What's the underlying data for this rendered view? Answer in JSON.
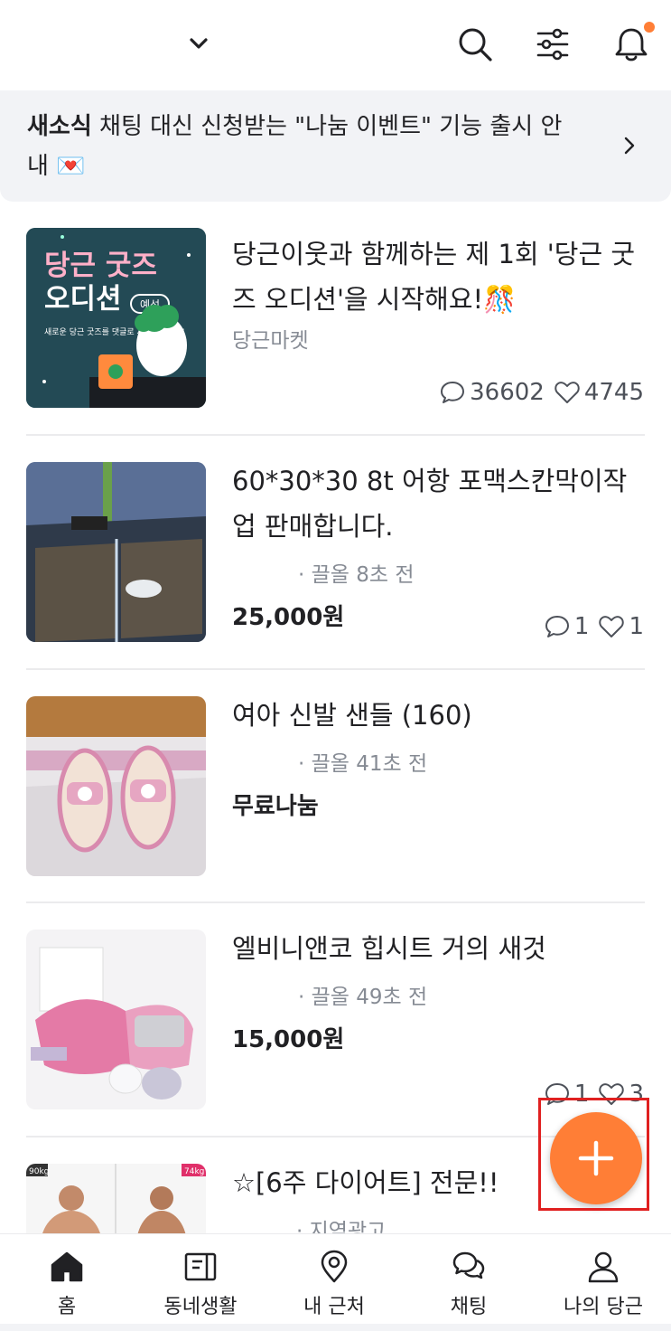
{
  "header": {
    "chevron_icon": "chevron-down-icon",
    "search_icon": "search-icon",
    "filter_icon": "sliders-icon",
    "bell_icon": "bell-icon",
    "accent": "#ff7e36"
  },
  "banner": {
    "tag": "새소식",
    "text": " 채팅 대신 신청받는 \"나눔 이벤트\" 기능 출시 안내 💌"
  },
  "feed": [
    {
      "title": "당근이웃과 함께하는 제 1회 '당근 굿즈 오디션'을 시작해요!🎊",
      "meta": "당근마켓",
      "price": "",
      "comments": "36602",
      "likes": "4745",
      "thumb_text_1": "당근 굿즈",
      "thumb_text_2": "오디션",
      "thumb_badge": "예선",
      "thumb_text_3": "새로운 당근 굿즈를 댓글로 제안해주세요!"
    },
    {
      "title": "60*30*30 8t 어항 포맥스칸막이작업 판매합니다.",
      "meta": "· 끌올 8초 전",
      "price": "25,000원",
      "comments": "1",
      "likes": "1"
    },
    {
      "title": "여아 신발 샌들 (160)",
      "meta": "· 끌올 41초 전",
      "price": "무료나눔",
      "comments": "",
      "likes": ""
    },
    {
      "title": "엘비니앤코 힙시트 거의 새것",
      "meta": "· 끌올 49초 전",
      "price": "15,000원",
      "comments": "1",
      "likes": "3"
    },
    {
      "title": "☆[6주 다이어트] 전문!!",
      "meta": "· 지역광고",
      "price": "",
      "comments": "",
      "likes": "",
      "thumb_tag_1": "90kg",
      "thumb_tag_2": "74kg"
    }
  ],
  "fab": {
    "icon": "plus-icon"
  },
  "nav": [
    {
      "label": "홈",
      "icon": "home-icon"
    },
    {
      "label": "동네생활",
      "icon": "document-icon"
    },
    {
      "label": "내 근처",
      "icon": "location-pin-icon"
    },
    {
      "label": "채팅",
      "icon": "chat-bubbles-icon"
    },
    {
      "label": "나의 당근",
      "icon": "person-icon"
    }
  ]
}
